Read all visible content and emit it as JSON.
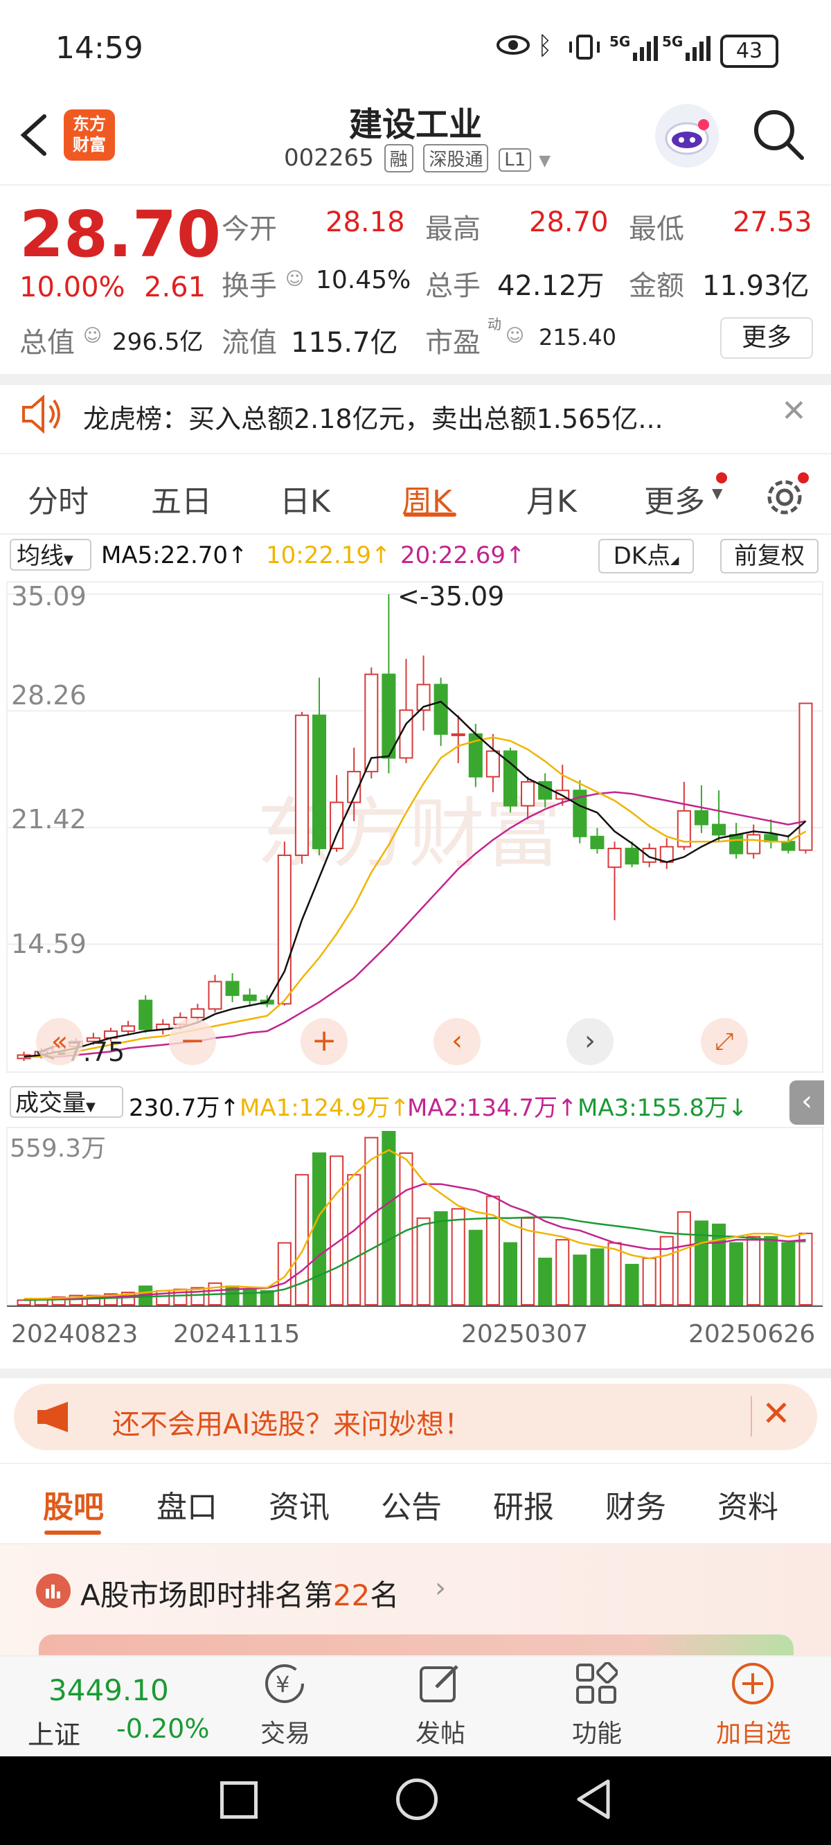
{
  "status_bar": {
    "time": "14:59",
    "battery": "43",
    "net1": "5G",
    "net2": "5G"
  },
  "header": {
    "logo_line1": "东方",
    "logo_line2": "财富",
    "title": "建设工业",
    "code": "002265",
    "tags": [
      "融",
      "深股通",
      "L1"
    ]
  },
  "quote": {
    "price": "28.70",
    "change_pct": "10.00%",
    "change": "2.61",
    "open_label": "今开",
    "open": "28.18",
    "high_label": "最高",
    "high": "28.70",
    "low_label": "最低",
    "low": "27.53",
    "turnover_label": "换手",
    "turnover": "10.45%",
    "volume_label": "总手",
    "volume": "42.12万",
    "amount_label": "金额",
    "amount": "11.93亿",
    "mktcap_label": "总值",
    "mktcap": "296.5亿",
    "float_label": "流值",
    "float": "115.7亿",
    "pe_label": "市盈",
    "pe_sup": "动",
    "pe": "215.40",
    "more": "更多"
  },
  "notice": {
    "text": "龙虎榜：买入总额2.18亿元，卖出总额1.565亿..."
  },
  "chart_tabs": [
    "分时",
    "五日",
    "日K",
    "周K",
    "月K",
    "更多"
  ],
  "chart_tabs_active": 3,
  "ma_bar": {
    "selector": "均线",
    "ma5": "MA5:22.70↑",
    "ma10": "10:22.19↑",
    "ma20": "20:22.69↑",
    "dk": "DK点",
    "adj": "前复权"
  },
  "vol_bar": {
    "selector": "成交量",
    "vol": "230.7万↑",
    "ma1": "MA1:124.9万↑",
    "ma2": "MA2:134.7万↑",
    "ma3": "MA3:155.8万↓"
  },
  "chart_labels": {
    "y_ticks": [
      "35.09",
      "28.26",
      "21.42",
      "14.59"
    ],
    "max_note": "<-35.09",
    "min_note": "<-7.75",
    "vol_max": "559.3万",
    "dates": [
      "20240823",
      "20241115",
      "20250307",
      "20250626"
    ]
  },
  "chart_data": {
    "type": "candlestick",
    "ylim": [
      7.75,
      35.09
    ],
    "candles": [
      {
        "o": 7.9,
        "c": 8.1,
        "h": 8.3,
        "l": 7.75
      },
      {
        "o": 8.0,
        "c": 8.3,
        "h": 8.5,
        "l": 7.9
      },
      {
        "o": 8.3,
        "c": 8.6,
        "h": 8.8,
        "l": 8.1
      },
      {
        "o": 8.6,
        "c": 8.9,
        "h": 9.1,
        "l": 8.4
      },
      {
        "o": 8.9,
        "c": 9.1,
        "h": 9.4,
        "l": 8.7
      },
      {
        "o": 9.1,
        "c": 9.5,
        "h": 9.7,
        "l": 8.9
      },
      {
        "o": 9.5,
        "c": 9.8,
        "h": 10.1,
        "l": 9.3
      },
      {
        "o": 11.3,
        "c": 9.6,
        "h": 11.6,
        "l": 9.4
      },
      {
        "o": 9.6,
        "c": 9.9,
        "h": 10.2,
        "l": 9.3
      },
      {
        "o": 9.9,
        "c": 10.3,
        "h": 10.6,
        "l": 9.6
      },
      {
        "o": 10.3,
        "c": 10.8,
        "h": 11.1,
        "l": 10.0
      },
      {
        "o": 10.8,
        "c": 12.4,
        "h": 12.8,
        "l": 10.6
      },
      {
        "o": 12.4,
        "c": 11.6,
        "h": 12.9,
        "l": 11.2
      },
      {
        "o": 11.6,
        "c": 11.3,
        "h": 12.0,
        "l": 11.0
      },
      {
        "o": 11.3,
        "c": 11.1,
        "h": 11.6,
        "l": 10.9
      },
      {
        "o": 11.1,
        "c": 19.8,
        "h": 20.6,
        "l": 11.0
      },
      {
        "o": 19.8,
        "c": 28.0,
        "h": 28.2,
        "l": 19.3
      },
      {
        "o": 28.0,
        "c": 20.2,
        "h": 30.2,
        "l": 19.8
      },
      {
        "o": 20.2,
        "c": 22.9,
        "h": 24.5,
        "l": 20.0
      },
      {
        "o": 22.9,
        "c": 24.7,
        "h": 26.1,
        "l": 21.8
      },
      {
        "o": 24.7,
        "c": 30.4,
        "h": 30.8,
        "l": 24.3
      },
      {
        "o": 30.4,
        "c": 25.5,
        "h": 35.09,
        "l": 24.6
      },
      {
        "o": 25.5,
        "c": 28.3,
        "h": 31.3,
        "l": 25.2
      },
      {
        "o": 28.3,
        "c": 29.8,
        "h": 31.5,
        "l": 27.1
      },
      {
        "o": 29.8,
        "c": 26.9,
        "h": 30.2,
        "l": 26.2
      },
      {
        "o": 26.9,
        "c": 26.9,
        "h": 28.0,
        "l": 25.2
      },
      {
        "o": 26.9,
        "c": 24.4,
        "h": 27.5,
        "l": 23.8
      },
      {
        "o": 24.4,
        "c": 25.9,
        "h": 26.9,
        "l": 23.5
      },
      {
        "o": 25.9,
        "c": 22.7,
        "h": 26.1,
        "l": 22.3
      },
      {
        "o": 22.7,
        "c": 24.1,
        "h": 24.4,
        "l": 21.9
      },
      {
        "o": 24.1,
        "c": 23.1,
        "h": 24.6,
        "l": 22.6
      },
      {
        "o": 23.1,
        "c": 23.6,
        "h": 25.1,
        "l": 22.7
      },
      {
        "o": 23.6,
        "c": 20.9,
        "h": 24.2,
        "l": 20.5
      },
      {
        "o": 20.9,
        "c": 20.2,
        "h": 21.4,
        "l": 19.9
      },
      {
        "o": 19.1,
        "c": 20.2,
        "h": 20.6,
        "l": 16.0
      },
      {
        "o": 20.2,
        "c": 19.3,
        "h": 20.6,
        "l": 19.1
      },
      {
        "o": 19.4,
        "c": 20.2,
        "h": 20.5,
        "l": 19.1
      },
      {
        "o": 19.4,
        "c": 20.3,
        "h": 20.8,
        "l": 19.0
      },
      {
        "o": 20.3,
        "c": 22.4,
        "h": 24.1,
        "l": 20.1
      },
      {
        "o": 22.4,
        "c": 21.6,
        "h": 23.9,
        "l": 21.1
      },
      {
        "o": 21.6,
        "c": 21.0,
        "h": 23.6,
        "l": 20.6
      },
      {
        "o": 21.0,
        "c": 19.9,
        "h": 21.7,
        "l": 19.6
      },
      {
        "o": 19.9,
        "c": 21.0,
        "h": 21.6,
        "l": 19.6
      },
      {
        "o": 21.0,
        "c": 20.6,
        "h": 21.9,
        "l": 20.2
      },
      {
        "o": 20.6,
        "c": 20.1,
        "h": 21.0,
        "l": 19.9
      },
      {
        "o": 20.1,
        "c": 28.7,
        "h": 28.7,
        "l": 19.9
      }
    ],
    "ma5": [
      8.0,
      8.1,
      8.3,
      8.5,
      8.8,
      9.1,
      9.3,
      9.5,
      9.6,
      9.7,
      10.0,
      10.5,
      10.8,
      11.0,
      11.2,
      13.0,
      16.0,
      18.5,
      21.0,
      23.2,
      25.5,
      25.6,
      27.5,
      28.5,
      28.8,
      27.9,
      26.9,
      26.0,
      25.2,
      24.3,
      23.8,
      23.3,
      22.7,
      22.3,
      21.2,
      20.5,
      19.7,
      19.4,
      19.7,
      20.3,
      20.8,
      21.0,
      21.2,
      21.1,
      20.9,
      21.8
    ],
    "ma10": [
      8.0,
      8.0,
      8.1,
      8.3,
      8.5,
      8.7,
      8.9,
      9.1,
      9.2,
      9.4,
      9.6,
      9.8,
      10.0,
      10.2,
      10.4,
      11.3,
      12.6,
      13.8,
      15.2,
      16.8,
      18.8,
      20.4,
      22.3,
      24.0,
      25.5,
      26.2,
      26.5,
      26.7,
      26.5,
      26.0,
      25.3,
      24.5,
      24.0,
      23.5,
      23.0,
      22.3,
      21.5,
      20.9,
      20.6,
      20.6,
      20.6,
      20.7,
      20.7,
      20.6,
      20.6,
      21.2
    ],
    "ma20": [
      8.0,
      8.0,
      8.0,
      8.1,
      8.2,
      8.3,
      8.5,
      8.6,
      8.7,
      8.8,
      8.9,
      9.1,
      9.2,
      9.4,
      9.5,
      10.0,
      10.6,
      11.2,
      11.9,
      12.6,
      13.6,
      14.6,
      15.7,
      16.8,
      17.9,
      19.0,
      19.9,
      20.7,
      21.4,
      22.0,
      22.5,
      22.9,
      23.2,
      23.4,
      23.5,
      23.4,
      23.2,
      23.0,
      22.8,
      22.6,
      22.4,
      22.2,
      22.0,
      21.8,
      21.6,
      21.8
    ],
    "volume": [
      15,
      20,
      25,
      30,
      30,
      35,
      40,
      60,
      45,
      50,
      55,
      70,
      60,
      50,
      45,
      200,
      420,
      490,
      480,
      420,
      540,
      559.3,
      490,
      280,
      300,
      310,
      240,
      350,
      200,
      280,
      150,
      210,
      160,
      180,
      200,
      130,
      150,
      220,
      300,
      270,
      260,
      200,
      220,
      220,
      200,
      230.7
    ],
    "vol_ma1": [
      20,
      20,
      22,
      24,
      28,
      30,
      34,
      40,
      45,
      48,
      50,
      56,
      60,
      57,
      55,
      90,
      170,
      290,
      360,
      420,
      470,
      500,
      470,
      400,
      360,
      320,
      300,
      290,
      260,
      240,
      230,
      220,
      200,
      190,
      180,
      160,
      150,
      160,
      180,
      200,
      210,
      220,
      230,
      230,
      220,
      230
    ],
    "vol_ma2": [
      18,
      19,
      20,
      22,
      24,
      26,
      28,
      32,
      36,
      40,
      42,
      46,
      50,
      52,
      54,
      70,
      110,
      160,
      200,
      240,
      290,
      330,
      370,
      390,
      390,
      380,
      370,
      350,
      320,
      300,
      270,
      250,
      240,
      220,
      200,
      190,
      180,
      180,
      190,
      200,
      200,
      210,
      210,
      210,
      205,
      210
    ],
    "vol_ma3": [
      15,
      16,
      17,
      18,
      20,
      22,
      24,
      26,
      28,
      30,
      32,
      34,
      36,
      38,
      40,
      50,
      70,
      95,
      120,
      150,
      180,
      210,
      240,
      260,
      270,
      275,
      278,
      280,
      280,
      282,
      283,
      280,
      270,
      262,
      255,
      248,
      240,
      232,
      228,
      225,
      222,
      220,
      215,
      210,
      205,
      205
    ]
  },
  "banner": {
    "text": "还不会用AI选股？来问妙想！"
  },
  "sub_tabs": [
    "股吧",
    "盘口",
    "资讯",
    "公告",
    "研报",
    "财务",
    "资料"
  ],
  "sub_tabs_active": 0,
  "rank": {
    "prefix": "A股市场即时排名第",
    "num": "22",
    "suffix": "名"
  },
  "index": {
    "value": "3449.10",
    "name": "上证",
    "change": "-0.20%"
  },
  "bottom_nav": [
    "交易",
    "发帖",
    "功能",
    "加自选"
  ],
  "colors": {
    "up": "#e02020",
    "down": "#3aa82f",
    "ma5": "#111111",
    "ma10": "#f0b400",
    "ma20": "#c2248f",
    "accent": "#e05a1a"
  }
}
